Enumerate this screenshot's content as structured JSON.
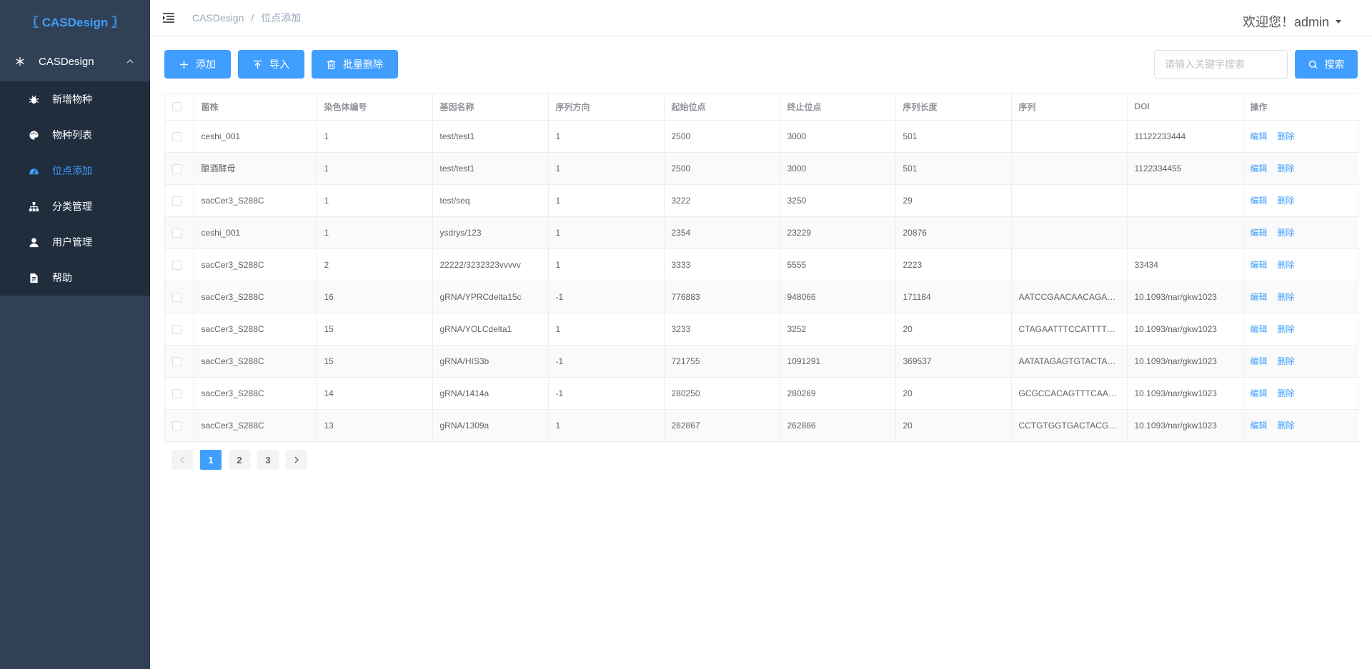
{
  "sidebar": {
    "logo": "〖 CASDesign 〗",
    "parent": "CASDesign",
    "items": [
      {
        "label": "新增物种",
        "icon": "bug-icon"
      },
      {
        "label": "物种列表",
        "icon": "palette-icon"
      },
      {
        "label": "位点添加",
        "icon": "dashboard-icon"
      },
      {
        "label": "分类管理",
        "icon": "tree-icon"
      },
      {
        "label": "用户管理",
        "icon": "user-icon"
      },
      {
        "label": "帮助",
        "icon": "document-icon"
      }
    ]
  },
  "header": {
    "breadcrumb": [
      "CASDesign",
      "位点添加"
    ],
    "breadcrumb_sep": "/",
    "user_greeting": "欢迎您！admin"
  },
  "toolbar": {
    "add_label": "添加",
    "import_label": "导入",
    "batch_delete_label": "批量删除",
    "search_placeholder": "请输入关键字搜索",
    "search_label": "搜索"
  },
  "table": {
    "columns": [
      "菌株",
      "染色体编号",
      "基因名称",
      "序列方向",
      "起始位点",
      "终止位点",
      "序列长度",
      "序列",
      "DOI",
      "操作"
    ],
    "edit_label": "编辑",
    "delete_label": "删除",
    "rows": [
      [
        "ceshi_001",
        "1",
        "test/test1",
        "1",
        "2500",
        "3000",
        "501",
        "",
        "11122233444"
      ],
      [
        "酿酒酵母",
        "1",
        "test/test1",
        "1",
        "2500",
        "3000",
        "501",
        "",
        "1122334455"
      ],
      [
        "sacCer3_S288C",
        "1",
        "test/seq",
        "1",
        "3222",
        "3250",
        "29",
        "",
        ""
      ],
      [
        "ceshi_001",
        "1",
        "ysdrys/123",
        "1",
        "2354",
        "23229",
        "20876",
        "",
        ""
      ],
      [
        "sacCer3_S288C",
        "2",
        "22222/3232323vvvvv",
        "1",
        "3333",
        "5555",
        "2223",
        "",
        "33434"
      ],
      [
        "sacCer3_S288C",
        "16",
        "gRNA/YPRCdelta15c",
        "-1",
        "776883",
        "948066",
        "171184",
        "AATCCGAACAACAGAGC...",
        "10.1093/nar/gkw1023"
      ],
      [
        "sacCer3_S288C",
        "15",
        "gRNA/YOLCdelta1",
        "1",
        "3233",
        "3252",
        "20",
        "CTAGAATTTCCATTTTGCGT",
        "10.1093/nar/gkw1023"
      ],
      [
        "sacCer3_S288C",
        "15",
        "gRNA/HIS3b",
        "-1",
        "721755",
        "1091291",
        "369537",
        "AATATAGAGTGTACTAGA...",
        "10.1093/nar/gkw1023"
      ],
      [
        "sacCer3_S288C",
        "14",
        "gRNA/1414a",
        "-1",
        "280250",
        "280269",
        "20",
        "GCGCCACAGTTTCAAGG...",
        "10.1093/nar/gkw1023"
      ],
      [
        "sacCer3_S288C",
        "13",
        "gRNA/1309a",
        "1",
        "262867",
        "262886",
        "20",
        "CCTGTGGTGACTACGTATCC",
        "10.1093/nar/gkw1023"
      ]
    ]
  },
  "pagination": {
    "pages": [
      "1",
      "2",
      "3"
    ],
    "current": "1"
  },
  "colors": {
    "sidebar_bg": "#304156",
    "submenu_bg": "#1f2d3d",
    "primary": "#409eff"
  }
}
